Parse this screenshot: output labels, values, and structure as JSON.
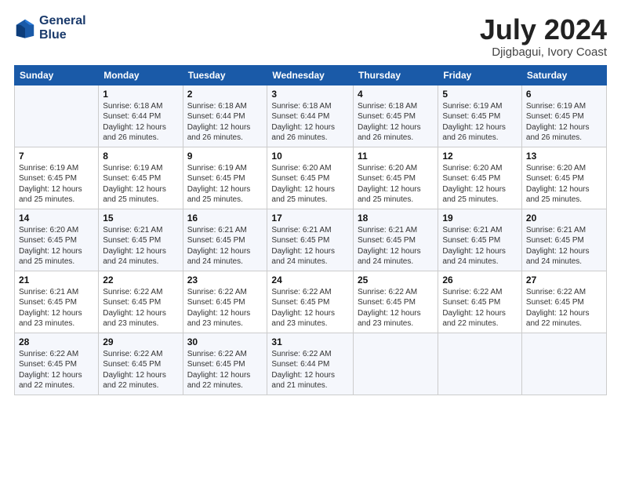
{
  "header": {
    "logo_line1": "General",
    "logo_line2": "Blue",
    "month": "July 2024",
    "location": "Djigbagui, Ivory Coast"
  },
  "weekdays": [
    "Sunday",
    "Monday",
    "Tuesday",
    "Wednesday",
    "Thursday",
    "Friday",
    "Saturday"
  ],
  "weeks": [
    [
      {
        "day": "",
        "sunrise": "",
        "sunset": "",
        "daylight": ""
      },
      {
        "day": "1",
        "sunrise": "Sunrise: 6:18 AM",
        "sunset": "Sunset: 6:44 PM",
        "daylight": "Daylight: 12 hours and 26 minutes."
      },
      {
        "day": "2",
        "sunrise": "Sunrise: 6:18 AM",
        "sunset": "Sunset: 6:44 PM",
        "daylight": "Daylight: 12 hours and 26 minutes."
      },
      {
        "day": "3",
        "sunrise": "Sunrise: 6:18 AM",
        "sunset": "Sunset: 6:44 PM",
        "daylight": "Daylight: 12 hours and 26 minutes."
      },
      {
        "day": "4",
        "sunrise": "Sunrise: 6:18 AM",
        "sunset": "Sunset: 6:45 PM",
        "daylight": "Daylight: 12 hours and 26 minutes."
      },
      {
        "day": "5",
        "sunrise": "Sunrise: 6:19 AM",
        "sunset": "Sunset: 6:45 PM",
        "daylight": "Daylight: 12 hours and 26 minutes."
      },
      {
        "day": "6",
        "sunrise": "Sunrise: 6:19 AM",
        "sunset": "Sunset: 6:45 PM",
        "daylight": "Daylight: 12 hours and 26 minutes."
      }
    ],
    [
      {
        "day": "7",
        "sunrise": "Sunrise: 6:19 AM",
        "sunset": "Sunset: 6:45 PM",
        "daylight": "Daylight: 12 hours and 25 minutes."
      },
      {
        "day": "8",
        "sunrise": "Sunrise: 6:19 AM",
        "sunset": "Sunset: 6:45 PM",
        "daylight": "Daylight: 12 hours and 25 minutes."
      },
      {
        "day": "9",
        "sunrise": "Sunrise: 6:19 AM",
        "sunset": "Sunset: 6:45 PM",
        "daylight": "Daylight: 12 hours and 25 minutes."
      },
      {
        "day": "10",
        "sunrise": "Sunrise: 6:20 AM",
        "sunset": "Sunset: 6:45 PM",
        "daylight": "Daylight: 12 hours and 25 minutes."
      },
      {
        "day": "11",
        "sunrise": "Sunrise: 6:20 AM",
        "sunset": "Sunset: 6:45 PM",
        "daylight": "Daylight: 12 hours and 25 minutes."
      },
      {
        "day": "12",
        "sunrise": "Sunrise: 6:20 AM",
        "sunset": "Sunset: 6:45 PM",
        "daylight": "Daylight: 12 hours and 25 minutes."
      },
      {
        "day": "13",
        "sunrise": "Sunrise: 6:20 AM",
        "sunset": "Sunset: 6:45 PM",
        "daylight": "Daylight: 12 hours and 25 minutes."
      }
    ],
    [
      {
        "day": "14",
        "sunrise": "Sunrise: 6:20 AM",
        "sunset": "Sunset: 6:45 PM",
        "daylight": "Daylight: 12 hours and 25 minutes."
      },
      {
        "day": "15",
        "sunrise": "Sunrise: 6:21 AM",
        "sunset": "Sunset: 6:45 PM",
        "daylight": "Daylight: 12 hours and 24 minutes."
      },
      {
        "day": "16",
        "sunrise": "Sunrise: 6:21 AM",
        "sunset": "Sunset: 6:45 PM",
        "daylight": "Daylight: 12 hours and 24 minutes."
      },
      {
        "day": "17",
        "sunrise": "Sunrise: 6:21 AM",
        "sunset": "Sunset: 6:45 PM",
        "daylight": "Daylight: 12 hours and 24 minutes."
      },
      {
        "day": "18",
        "sunrise": "Sunrise: 6:21 AM",
        "sunset": "Sunset: 6:45 PM",
        "daylight": "Daylight: 12 hours and 24 minutes."
      },
      {
        "day": "19",
        "sunrise": "Sunrise: 6:21 AM",
        "sunset": "Sunset: 6:45 PM",
        "daylight": "Daylight: 12 hours and 24 minutes."
      },
      {
        "day": "20",
        "sunrise": "Sunrise: 6:21 AM",
        "sunset": "Sunset: 6:45 PM",
        "daylight": "Daylight: 12 hours and 24 minutes."
      }
    ],
    [
      {
        "day": "21",
        "sunrise": "Sunrise: 6:21 AM",
        "sunset": "Sunset: 6:45 PM",
        "daylight": "Daylight: 12 hours and 23 minutes."
      },
      {
        "day": "22",
        "sunrise": "Sunrise: 6:22 AM",
        "sunset": "Sunset: 6:45 PM",
        "daylight": "Daylight: 12 hours and 23 minutes."
      },
      {
        "day": "23",
        "sunrise": "Sunrise: 6:22 AM",
        "sunset": "Sunset: 6:45 PM",
        "daylight": "Daylight: 12 hours and 23 minutes."
      },
      {
        "day": "24",
        "sunrise": "Sunrise: 6:22 AM",
        "sunset": "Sunset: 6:45 PM",
        "daylight": "Daylight: 12 hours and 23 minutes."
      },
      {
        "day": "25",
        "sunrise": "Sunrise: 6:22 AM",
        "sunset": "Sunset: 6:45 PM",
        "daylight": "Daylight: 12 hours and 23 minutes."
      },
      {
        "day": "26",
        "sunrise": "Sunrise: 6:22 AM",
        "sunset": "Sunset: 6:45 PM",
        "daylight": "Daylight: 12 hours and 22 minutes."
      },
      {
        "day": "27",
        "sunrise": "Sunrise: 6:22 AM",
        "sunset": "Sunset: 6:45 PM",
        "daylight": "Daylight: 12 hours and 22 minutes."
      }
    ],
    [
      {
        "day": "28",
        "sunrise": "Sunrise: 6:22 AM",
        "sunset": "Sunset: 6:45 PM",
        "daylight": "Daylight: 12 hours and 22 minutes."
      },
      {
        "day": "29",
        "sunrise": "Sunrise: 6:22 AM",
        "sunset": "Sunset: 6:45 PM",
        "daylight": "Daylight: 12 hours and 22 minutes."
      },
      {
        "day": "30",
        "sunrise": "Sunrise: 6:22 AM",
        "sunset": "Sunset: 6:45 PM",
        "daylight": "Daylight: 12 hours and 22 minutes."
      },
      {
        "day": "31",
        "sunrise": "Sunrise: 6:22 AM",
        "sunset": "Sunset: 6:44 PM",
        "daylight": "Daylight: 12 hours and 21 minutes."
      },
      {
        "day": "",
        "sunrise": "",
        "sunset": "",
        "daylight": ""
      },
      {
        "day": "",
        "sunrise": "",
        "sunset": "",
        "daylight": ""
      },
      {
        "day": "",
        "sunrise": "",
        "sunset": "",
        "daylight": ""
      }
    ]
  ]
}
